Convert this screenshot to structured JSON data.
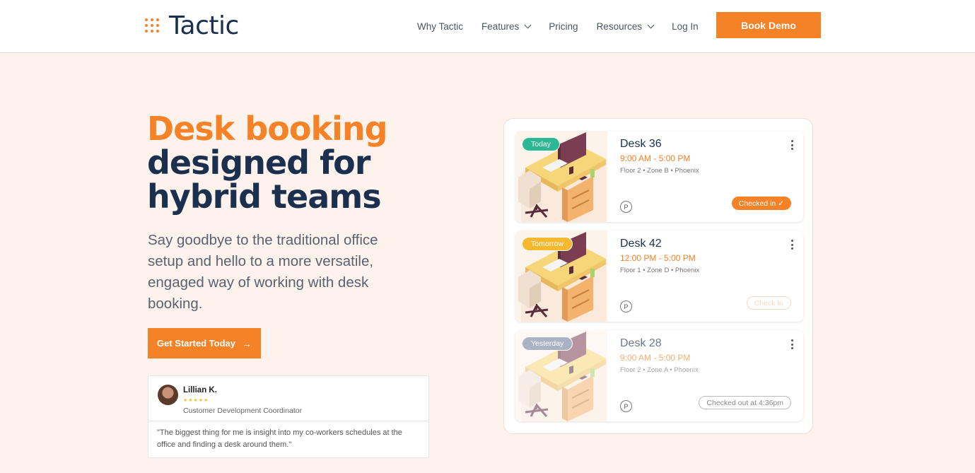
{
  "header": {
    "logo_text": "Tactic",
    "nav": [
      "Why Tactic",
      "Features",
      "Pricing",
      "Resources",
      "Log In"
    ],
    "cta": "Book Demo"
  },
  "hero": {
    "title_line1": "Desk booking",
    "title_line2": "designed for",
    "title_line3": "hybrid teams",
    "subtitle": "Say goodbye to the traditional office setup and hello to a more versatile, engaged way of working with desk booking.",
    "cta": "Get Started Today"
  },
  "testimonial": {
    "name": "Lillian K.",
    "stars": "★★★★★",
    "role": "Customer Development Coordinator",
    "quote": "\"The biggest thing for me is insight into my co-workers schedules at the office and finding a desk around them.\""
  },
  "bookings": [
    {
      "day": "Today",
      "day_color": "#2bb892",
      "desk": "Desk 36",
      "time": "9:00 AM - 5:00 PM",
      "location": "Floor 2  •  Zone B  •  Phoenix",
      "parking": "P",
      "status": "Checked in ✓"
    },
    {
      "day": "Tomorrow",
      "day_color": "#f5b82e",
      "desk": "Desk 42",
      "time": "12:00 PM - 5:00 PM",
      "location": "Floor 1  •  Zone D  •  Phoenix",
      "parking": "P",
      "status": "Check In"
    },
    {
      "day": "Yesterday",
      "day_color": "#a9b3c4",
      "desk": "Desk 28",
      "time": "9:00 AM - 5:00 PM",
      "location": "Floor 2  •  Zone A  •  Phoenix",
      "parking": "P",
      "status": "Checked out at 4:36pm"
    }
  ],
  "colors": {
    "brand_orange": "#f58226",
    "navy": "#1b2f4e",
    "background": "#fdf3ec"
  }
}
